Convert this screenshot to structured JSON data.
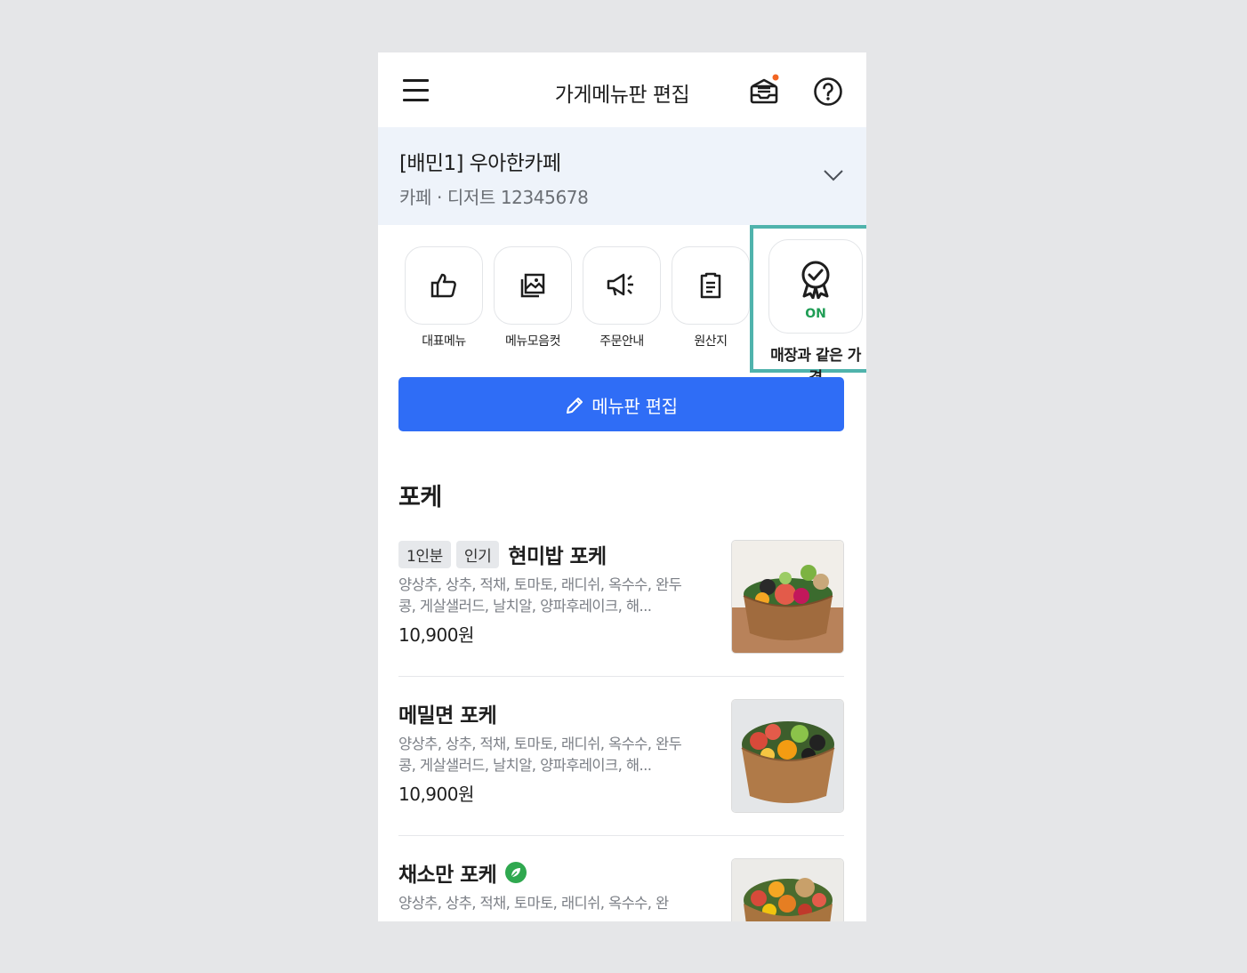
{
  "header": {
    "title": "가게메뉴판 편집",
    "icons": [
      "hamburger-icon",
      "inbox-icon",
      "help-icon"
    ],
    "notification_dot_color": "#f26522"
  },
  "store": {
    "name": "[배민1] 우아한카페",
    "sub": "카페 · 디저트 12345678"
  },
  "quick_actions": [
    {
      "label": "대표메뉴",
      "icon": "thumbs-up-icon"
    },
    {
      "label": "메뉴모음컷",
      "icon": "gallery-icon"
    },
    {
      "label": "주문안내",
      "icon": "megaphone-icon"
    },
    {
      "label": "원산지",
      "icon": "document-icon"
    }
  ],
  "same_price": {
    "label": "매장과 같은 가격",
    "status": "ON",
    "icon": "badge-check-icon",
    "status_color": "#1f9d55",
    "highlight_color": "#4fb3ac"
  },
  "edit_button": {
    "label": "메뉴판 편집",
    "color": "#2f6df6"
  },
  "section": {
    "title": "포케"
  },
  "items": [
    {
      "tags": [
        "1인분",
        "인기"
      ],
      "name": "현미밥 포케",
      "desc": "양상추, 상추, 적채, 토마토, 래디쉬, 옥수수, 완두콩, 게살샐러드, 날치알, 양파후레이크, 해...",
      "price": "10,900원"
    },
    {
      "tags": [],
      "name": "메밀면 포케",
      "desc": "양상추, 상추, 적채, 토마토, 래디쉬, 옥수수, 완두콩, 게살샐러드, 날치알, 양파후레이크, 해...",
      "price": "10,900원"
    },
    {
      "tags": [],
      "name": "채소만 포케",
      "badge": "leaf-icon",
      "desc": "양상추, 상추, 적채, 토마토, 래디쉬, 옥수수, 완",
      "price": ""
    }
  ]
}
